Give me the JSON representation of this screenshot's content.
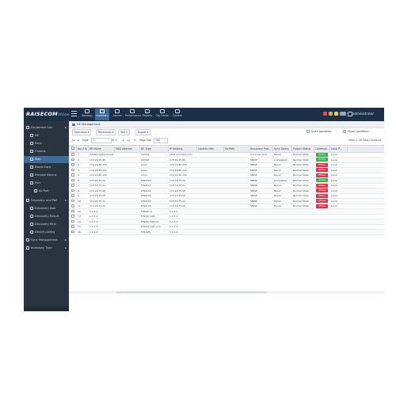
{
  "header": {
    "logo": "RAISECOM",
    "logo_sub": "NView",
    "nav": [
      {
        "label": "Topology",
        "icon": "topology-icon"
      },
      {
        "label": "Inventory",
        "icon": "inventory-icon",
        "active": true
      },
      {
        "label": "Alarms",
        "icon": "bell-icon"
      },
      {
        "label": "Performance",
        "icon": "chart-icon"
      },
      {
        "label": "Reports",
        "icon": "report-icon"
      },
      {
        "label": "Cfg Center",
        "icon": "config-icon"
      },
      {
        "label": "System",
        "icon": "gear-icon"
      }
    ],
    "user": "administrator"
  },
  "colors": {
    "topbar": "#1d2f44",
    "sidebar": "#2a3440",
    "selected": "#3c6d9c",
    "online": "#2ebd3f",
    "offline": "#e0344a"
  },
  "sidebar": {
    "items": [
      {
        "label": "Equipment List",
        "icon": "list-icon"
      },
      {
        "label": "NE",
        "icon": "device-icon",
        "indent": 1
      },
      {
        "label": "Rack",
        "icon": "rack-icon",
        "indent": 1
      },
      {
        "label": "Chassis",
        "icon": "chassis-icon",
        "indent": 1
      },
      {
        "label": "Slot",
        "icon": "slot-icon",
        "indent": 1,
        "selected": true
      },
      {
        "label": "Board Card",
        "icon": "card-icon",
        "indent": 1
      },
      {
        "label": "Remote Device",
        "icon": "remote-icon",
        "indent": 1
      },
      {
        "label": "Port",
        "icon": "port-icon",
        "indent": 1
      },
      {
        "label": "All Port",
        "icon": "port-icon",
        "indent": 2
      },
      {
        "label": "Discovery and Poll",
        "icon": "discovery-icon"
      },
      {
        "label": "Discovery task",
        "icon": "task-icon",
        "indent": 1
      },
      {
        "label": "Discovery Result",
        "icon": "result-icon",
        "indent": 1
      },
      {
        "label": "Discovery filter",
        "icon": "filter-icon",
        "indent": 1
      },
      {
        "label": "Device polling",
        "icon": "polling-icon",
        "indent": 1
      },
      {
        "label": "Sync Management",
        "icon": "sync-icon"
      },
      {
        "label": "Inventory Type",
        "icon": "type-icon"
      }
    ]
  },
  "main": {
    "breadcrumb": "NE Management",
    "toolbar": {
      "buttons": [
        "Operation ▾",
        "Reconnect ▾",
        "Tool ▾",
        "Export ▾"
      ],
      "options": [
        "Quick operation",
        "Show Conditions"
      ]
    },
    "pager": {
      "page_label": "Page",
      "page_value": "1",
      "of_label": "of 1",
      "page_size_label": "Page Size",
      "page_size": "100",
      "total": "Item: 1-16 Total Count:16"
    },
    "columns": [
      "",
      "No.(16)",
      "NE Name",
      "MAC Address",
      "NE Type",
      "IP Address",
      "Location Nm",
      "Up Path",
      "Discovery Prot...",
      "Sync Status",
      "Project Status",
      "Communi...",
      "Local P..."
    ],
    "rows": [
      [
        "1",
        "SiteName@example",
        "",
        "ISCOM",
        "site1.example.com",
        "",
        "",
        "Unknown Prot...",
        "Never",
        "Normal State",
        "Online",
        "Local"
      ],
      [
        "2",
        "172.16.75.60",
        "",
        "ISCOM",
        "172.16.75.60",
        "",
        "",
        "SNMP",
        "Completed",
        "Normal State",
        "Online",
        "Local"
      ],
      [
        "3",
        "172.16.80.250",
        "",
        "Linux",
        "172.16.80.250",
        "",
        "",
        "SNMP",
        "Never",
        "Normal State",
        "Offline",
        "Local"
      ],
      [
        "4",
        "172.16.80.231",
        "",
        "Linux",
        "172.16.80.231",
        "",
        "",
        "SNMP",
        "Never",
        "Normal State",
        "Offline",
        "Local"
      ],
      [
        "5",
        "172.16.80.242",
        "",
        "Linux",
        "172.16.80.242",
        "",
        "",
        "SNMP",
        "Never",
        "Normal State",
        "Offline",
        "Local"
      ],
      [
        "6",
        "172.16.75.22",
        "",
        "ITN2100",
        "172.16.75.22",
        "",
        "",
        "SNMP",
        "Completed",
        "Normal State",
        "Online",
        "Local"
      ],
      [
        "7",
        "172.16.75.61",
        "",
        "ITN2100",
        "172.16.75.61",
        "",
        "",
        "SNMP",
        "Never",
        "Normal State",
        "Offline",
        "Local"
      ],
      [
        "8",
        "172.16.75.58",
        "",
        "ITN2100",
        "172.16.75.58",
        "",
        "",
        "SNMP",
        "Never",
        "Normal State",
        "Offline",
        "Local"
      ],
      [
        "9",
        "172.16.75.59",
        "",
        "ITN2100",
        "172.16.75.59",
        "",
        "",
        "SNMP",
        "Never",
        "Normal State",
        "Offline",
        "Local"
      ],
      [
        "10",
        "172.16.75.21",
        "",
        "ITN2100",
        "172.16.75.21",
        "",
        "",
        "SNMP",
        "Failed",
        "Normal State",
        "Offline",
        "Local"
      ],
      [
        "11",
        "172.16.75.20",
        "",
        "ITN2100",
        "172.16.75.20",
        "",
        "",
        "SNMP",
        "Never",
        "Normal State",
        "Offline",
        "Local"
      ],
      [
        "12",
        "1.1.1.1",
        "",
        "ITN167-A",
        "1.1.1.1",
        "",
        "",
        "",
        "",
        "",
        "",
        ""
      ],
      [
        "13",
        "1.1.1.2",
        "",
        "ITN167-A(E)",
        "1.1.1.2",
        "",
        "",
        "",
        "",
        "",
        "",
        ""
      ],
      [
        "14",
        "1.1.1.3",
        "",
        "ITN167-A(E)+S",
        "1.1.1.3",
        "",
        "",
        "",
        "",
        "",
        "",
        ""
      ],
      [
        "15",
        "1.1.1.4",
        "",
        "ITN167-A(E)+DC",
        "1.1.1.4",
        "",
        "",
        "",
        "",
        "",
        "",
        ""
      ],
      [
        "16",
        "1.1.1.5",
        "",
        "ITN-A(E)",
        "1.1.1.5",
        "",
        "",
        "",
        "",
        "",
        "",
        ""
      ]
    ]
  }
}
